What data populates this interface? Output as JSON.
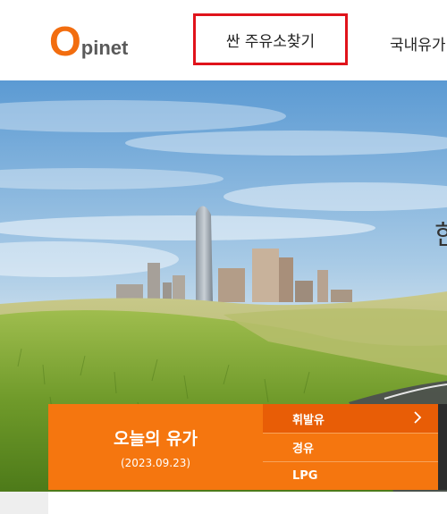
{
  "header": {
    "logo_o": "O",
    "logo_rest": "pinet",
    "nav_highlight_label": "싼 주유소찾기",
    "nav_item_2_label": "국내유가"
  },
  "hero": {
    "partial_text": "한"
  },
  "today_price": {
    "title": "오늘의 유가",
    "date": "(2023.09.23)"
  },
  "fuel_types": [
    {
      "label": "휘발유"
    },
    {
      "label": "경유"
    },
    {
      "label": "LPG"
    }
  ],
  "colors": {
    "brand_orange": "#f26d0f",
    "panel_orange": "#f5760f",
    "panel_orange_dark": "#e85d06",
    "highlight_red": "#e0131b"
  }
}
